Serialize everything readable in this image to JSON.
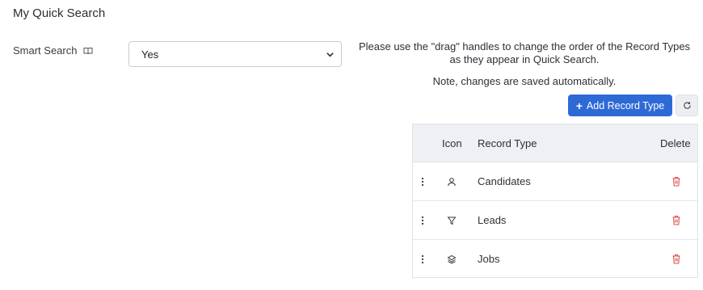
{
  "page": {
    "title": "My Quick Search"
  },
  "smart_search": {
    "label": "Smart Search",
    "icon": "book-icon",
    "selected_value": "Yes"
  },
  "info": {
    "instructions": "Please use the \"drag\" handles to change the order of the Record Types as they appear in Quick Search.",
    "note": "Note, changes are saved automatically."
  },
  "toolbar": {
    "add_label": "Add Record Type",
    "accent_color": "#2e6ad6"
  },
  "table": {
    "headers": {
      "icon": "Icon",
      "record_type": "Record Type",
      "delete": "Delete"
    },
    "rows": [
      {
        "icon": "user-icon",
        "label": "Candidates"
      },
      {
        "icon": "funnel-icon",
        "label": "Leads"
      },
      {
        "icon": "layers-icon",
        "label": "Jobs"
      }
    ],
    "delete_color": "#d9534f"
  }
}
